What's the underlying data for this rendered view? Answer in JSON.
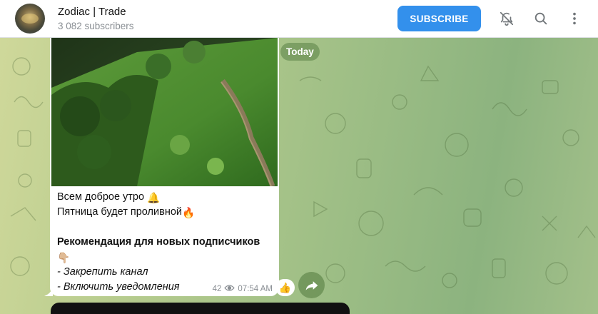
{
  "header": {
    "title": "Zodiac | Trade",
    "subtitle": "3 082 subscribers",
    "subscribe_label": "SUBSCRIBE",
    "icons": [
      "bell-off-icon",
      "search-icon",
      "more-vertical-icon"
    ]
  },
  "chat": {
    "date_label": "Today"
  },
  "message": {
    "line1": "Всем доброе утро",
    "line1_emoji": "🔔",
    "line2": "Пятница будет проливной",
    "line2_emoji": "🔥",
    "heading": "Рекомендация для новых подписчиков",
    "heading_emoji": "👇🏼",
    "item1": "- Закрепить канал",
    "item2": "- Включить уведомления",
    "views": "42",
    "time": "07:54 AM",
    "reaction_emoji": "👍"
  },
  "colors": {
    "accent": "#3390ec",
    "bubble": "#ffffff",
    "meta_text": "#8a8f94"
  }
}
